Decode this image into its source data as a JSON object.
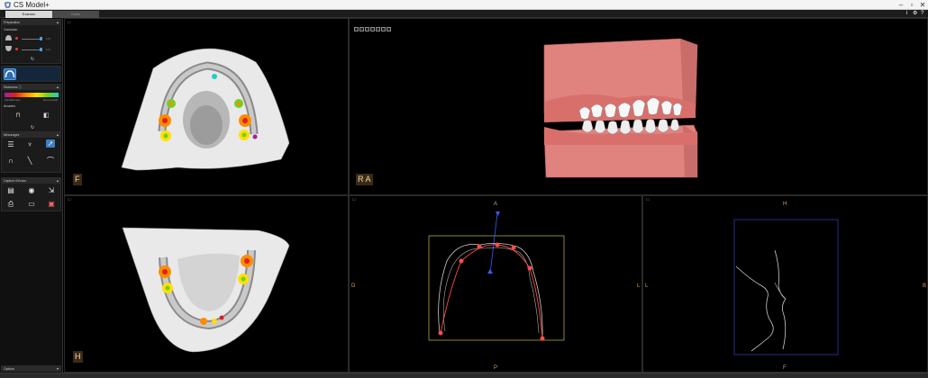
{
  "window": {
    "title": "CS Model+",
    "minimize": "–",
    "restore": "▫",
    "close": "✕"
  },
  "tabs": [
    {
      "label": "Examen"
    },
    {
      "label": "Outils"
    }
  ],
  "tabrow_icons": {
    "info": "i",
    "settings": "⚙",
    "help": "?"
  },
  "left_panel": {
    "group_prep": {
      "title": "Préparation",
      "section_occlusion": "Occlusion",
      "slider1_value": "100",
      "slider2_value": "100"
    },
    "group_dist": {
      "title": "Distances",
      "legend_left": "Interférences",
      "legend_right": "Non-contact",
      "section_arcs": "Arcades"
    },
    "group_mesures": {
      "title": "Mesurages"
    },
    "group_capture": {
      "title": "Capture d'écran"
    },
    "group_options": {
      "title": "Options"
    }
  },
  "colors": {
    "gum": "#e6807c",
    "accent_blue": "#4aa3f0",
    "label_bg": "#3a2a18",
    "label_fg": "#f3d9a4",
    "axis_orange": "#d9a25c",
    "ortho_box_yellow": "#b0a830",
    "ortho_box_blue": "#2e3cb0",
    "landmark_red": "#ff4b4b",
    "axis_blue": "#3a5cff",
    "distance_map": [
      "#a020a0",
      "#e02020",
      "#ff8c00",
      "#ffe000",
      "#70d020",
      "#20d0c0"
    ]
  },
  "viewports": {
    "top_left": {
      "label": "F",
      "corner": "☐"
    },
    "top_right": {
      "label": "R A",
      "corner": "☐"
    },
    "bottom_left": {
      "label": "H",
      "corner": "☐"
    },
    "bottom_mid": {
      "corner": "☐",
      "axis_top": "A",
      "axis_bottom": "P",
      "axis_left": "D",
      "axis_right": "L"
    },
    "bottom_right": {
      "corner": "☐",
      "axis_top": "H",
      "axis_bottom": "F",
      "axis_left": "L",
      "axis_right": "B"
    }
  }
}
